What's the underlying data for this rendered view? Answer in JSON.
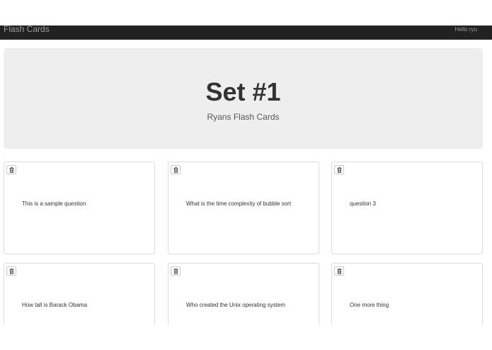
{
  "navbar": {
    "brand": "Flash Cards",
    "greeting": "Hello ryu"
  },
  "header": {
    "title": "Set #1",
    "subtitle": "Ryans Flash Cards"
  },
  "cards": [
    {
      "question": "This is a sample question",
      "delete_icon": "trash-icon"
    },
    {
      "question": "What is the time complexity of bubble sort",
      "delete_icon": "trash-icon"
    },
    {
      "question": "question 3",
      "delete_icon": "trash-icon"
    },
    {
      "question": "How tall is Barack Obama",
      "delete_icon": "trash-icon"
    },
    {
      "question": "Who created the Unix operating system",
      "delete_icon": "trash-icon"
    },
    {
      "question": "One more thing",
      "delete_icon": "trash-icon"
    }
  ],
  "colors": {
    "navbar": "#222222",
    "jumbotron": "#eeeeee",
    "nav_text": "#9d9d9d"
  }
}
